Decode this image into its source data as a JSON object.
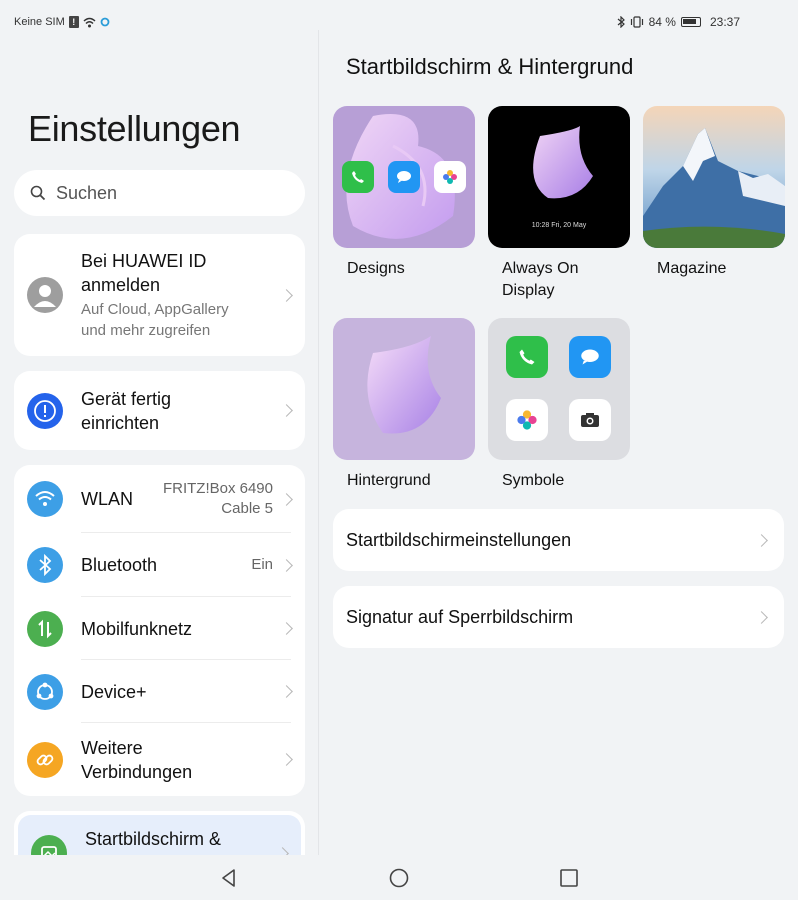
{
  "status_bar": {
    "carrier": "Keine SIM",
    "battery": "84 %",
    "time": "23:37"
  },
  "left": {
    "title": "Einstellungen",
    "search_placeholder": "Suchen",
    "account": {
      "title_line1": "Bei HUAWEI ID",
      "title_line2": "anmelden",
      "sub_line1": "Auf Cloud, AppGallery",
      "sub_line2": "und mehr zugreifen"
    },
    "setup": {
      "line1": "Gerät fertig",
      "line2": "einrichten"
    },
    "connections": [
      {
        "label": "WLAN",
        "value_line1": "FRITZ!Box 6490",
        "value_line2": "Cable 5",
        "icon": "wifi-icon",
        "color": "#3d9fe6"
      },
      {
        "label": "Bluetooth",
        "value_line1": "Ein",
        "icon": "bluetooth-icon",
        "color": "#3d9fe6"
      },
      {
        "label": "Mobilfunknetz",
        "icon": "mobile-data-icon",
        "color": "#4caf50"
      },
      {
        "label": "Device+",
        "icon": "device-plus-icon",
        "color": "#3d9fe6"
      },
      {
        "label_line1": "Weitere",
        "label_line2": "Verbindungen",
        "icon": "link-icon",
        "color": "#f5a623"
      }
    ],
    "home_item": {
      "label": "Startbildschirm &"
    }
  },
  "right": {
    "title": "Startbildschirm & Hintergrund",
    "tiles": [
      {
        "label": "Designs"
      },
      {
        "label_line1": "Always On",
        "label_line2": "Display",
        "clock": "10:28",
        "date": "Fri, 20 May"
      },
      {
        "label": "Magazine"
      },
      {
        "label": "Hintergrund"
      },
      {
        "label": "Symbole"
      }
    ],
    "settings": [
      {
        "label": "Startbildschirmeinstellungen"
      },
      {
        "label": "Signatur auf Sperrbildschirm"
      }
    ]
  },
  "colors": {
    "background": "#f1f3f5",
    "accent_blue": "#3d9fe6",
    "warning_blue": "#2463eb",
    "home_selected_bg": "#e6eefb"
  }
}
